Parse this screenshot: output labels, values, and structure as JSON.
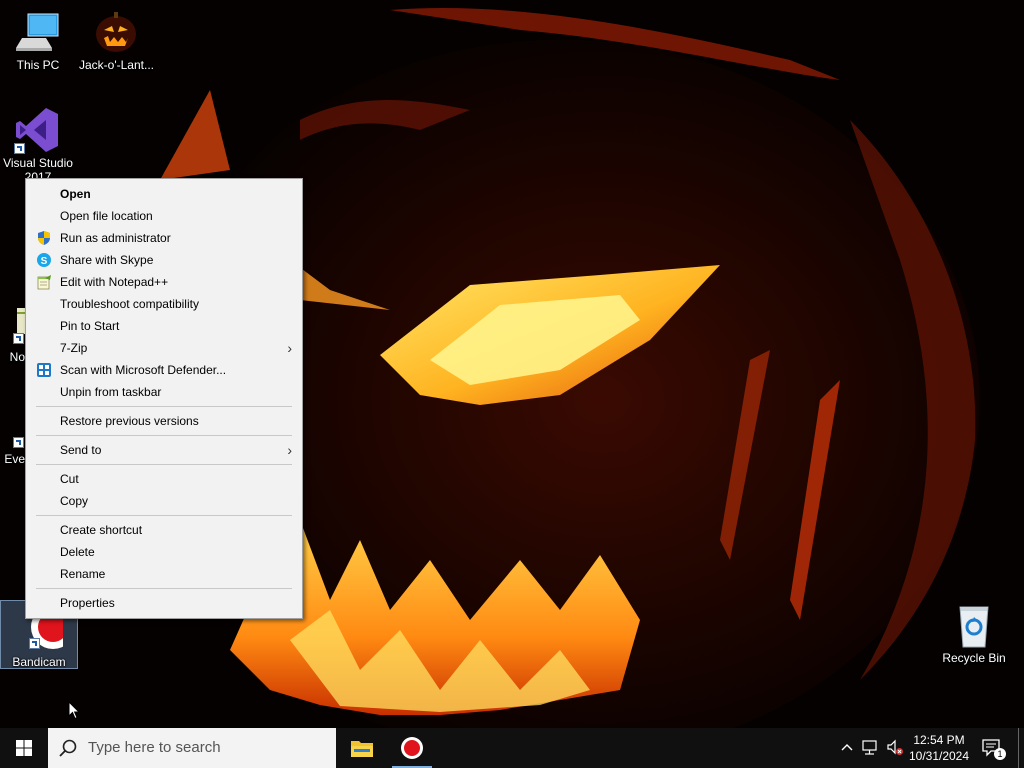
{
  "desktop": {
    "icons": [
      {
        "label": "This PC"
      },
      {
        "label": "Jack-o'-Lant..."
      },
      {
        "label": "Visual Studio 2017"
      },
      {
        "label": "No"
      },
      {
        "label": "Eve"
      },
      {
        "label": "Bandicam"
      },
      {
        "label": "Recycle Bin"
      }
    ]
  },
  "context_menu": {
    "groups": [
      [
        {
          "label": "Open",
          "default": true
        },
        {
          "label": "Open file location"
        },
        {
          "label": "Run as administrator",
          "icon": "shield-icon"
        },
        {
          "label": "Share with Skype",
          "icon": "skype-icon"
        },
        {
          "label": "Edit with Notepad++",
          "icon": "notepadpp-icon"
        },
        {
          "label": "Troubleshoot compatibility"
        },
        {
          "label": "Pin to Start"
        },
        {
          "label": "7-Zip",
          "submenu": true
        },
        {
          "label": "Scan with Microsoft Defender...",
          "icon": "defender-icon"
        },
        {
          "label": "Unpin from taskbar"
        }
      ],
      [
        {
          "label": "Restore previous versions"
        }
      ],
      [
        {
          "label": "Send to",
          "submenu": true
        }
      ],
      [
        {
          "label": "Cut"
        },
        {
          "label": "Copy"
        }
      ],
      [
        {
          "label": "Create shortcut"
        },
        {
          "label": "Delete"
        },
        {
          "label": "Rename"
        }
      ],
      [
        {
          "label": "Properties"
        }
      ]
    ],
    "submenu_arrow": "›"
  },
  "taskbar": {
    "search_placeholder": "Type here to search",
    "clock_time": "12:54 PM",
    "clock_date": "10/31/2024",
    "notification_count": "1",
    "pinned_apps": [
      "file-explorer-icon",
      "bandicam-icon"
    ]
  },
  "colors": {
    "menu_bg": "#f2f2f2",
    "taskbar_bg": "#101010",
    "accent": "#7fb0e0"
  }
}
